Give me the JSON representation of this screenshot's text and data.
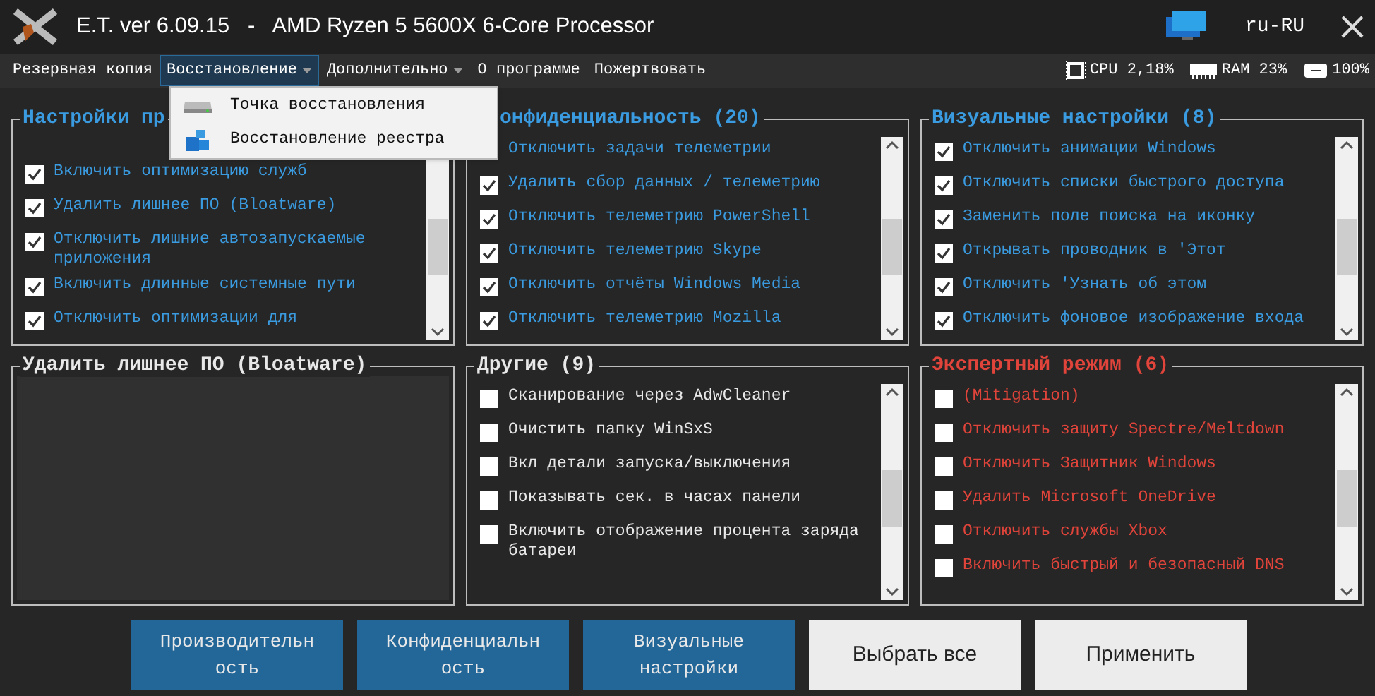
{
  "window": {
    "title": "E.T. ver 6.09.15   -   AMD Ryzen 5 5600X 6-Core Processor",
    "language": "ru-RU"
  },
  "menu": [
    {
      "label": "Резервная копия",
      "dropdown": false,
      "open": false
    },
    {
      "label": "Восстановление",
      "dropdown": true,
      "open": true
    },
    {
      "label": "Дополнительно",
      "dropdown": true,
      "open": false
    },
    {
      "label": "О программе",
      "dropdown": false,
      "open": false
    },
    {
      "label": "Пожертвовать",
      "dropdown": false,
      "open": false
    }
  ],
  "dropdown_items": [
    {
      "label": "Точка восстановления",
      "kind": "drive"
    },
    {
      "label": "Восстановление реестра",
      "kind": "registry"
    }
  ],
  "status": {
    "cpu": "CPU 2,18%",
    "ram": "RAM 23%",
    "battery": "100%"
  },
  "panels": [
    {
      "title": "Настройки пр",
      "kind": "normal",
      "items": [
        {
          "label": "Включить оптимизацию служб",
          "checked": true
        },
        {
          "label": "Удалить лишнее ПО (Bloatware)",
          "checked": true
        },
        {
          "label": "Отключить лишние автозапускаемые приложения",
          "checked": true
        },
        {
          "label": "Включить длинные системные пути",
          "checked": true
        },
        {
          "label": "Отключить оптимизации для",
          "checked": true
        }
      ]
    },
    {
      "title": "онфиденциальность (20)",
      "kind": "normal",
      "items": [
        {
          "label": "Отключить задачи телеметрии"
        },
        {
          "label": "Удалить сбор данных / телеметрию",
          "checked": true
        },
        {
          "label": "Отключить телеметрию PowerShell",
          "checked": true
        },
        {
          "label": "Отключить телеметрию Skype",
          "checked": true
        },
        {
          "label": "Отключить отчёты Windows Media",
          "checked": true
        },
        {
          "label": "Отключить телеметрию Mozilla",
          "checked": true
        }
      ]
    },
    {
      "title": "Визуальные настройки (8)",
      "kind": "normal",
      "items": [
        {
          "label": "Отключить анимации Windows",
          "checked": true
        },
        {
          "label": "Отключить списки быстрого доступа",
          "checked": true
        },
        {
          "label": "Заменить поле поиска на иконку",
          "checked": true
        },
        {
          "label": "Открывать проводник в 'Этот",
          "checked": true
        },
        {
          "label": "Отключить 'Узнать об этом",
          "checked": true
        },
        {
          "label": "Отключить фоновое изображение входа",
          "checked": true
        }
      ]
    },
    {
      "title": "Удалить лишнее ПО (Bloatware)",
      "kind": "empty"
    },
    {
      "title": "Другие (9)",
      "kind": "plain",
      "items": [
        {
          "label": "Сканирование через AdwCleaner",
          "checked": false
        },
        {
          "label": "Очистить папку WinSxS",
          "checked": false
        },
        {
          "label": "Вкл детали запуска/выключения",
          "checked": false
        },
        {
          "label": "Показывать сек. в часах панели",
          "checked": false
        },
        {
          "label": "Включить отображение процента заряда батареи",
          "checked": false
        }
      ]
    },
    {
      "title": "Экспертный режим (6)",
      "kind": "expert",
      "items": [
        {
          "label": "(Mitigation)",
          "checked": false
        },
        {
          "label": "Отключить защиту Spectre/Meltdown",
          "checked": false
        },
        {
          "label": "Отключить Защитник Windows",
          "checked": false
        },
        {
          "label": "Удалить Microsoft OneDrive",
          "checked": false
        },
        {
          "label": "Отключить службы Xbox",
          "checked": false
        },
        {
          "label": "Включить быстрый и безопасный DNS",
          "checked": false
        }
      ]
    }
  ],
  "buttons": [
    {
      "label": "Производительность",
      "kind": "category"
    },
    {
      "label": "Конфиденциальность",
      "kind": "category"
    },
    {
      "label": "Визуальные настройки",
      "kind": "category"
    },
    {
      "label": "Выбрать все",
      "kind": "action"
    },
    {
      "label": "Применить",
      "kind": "action"
    }
  ]
}
